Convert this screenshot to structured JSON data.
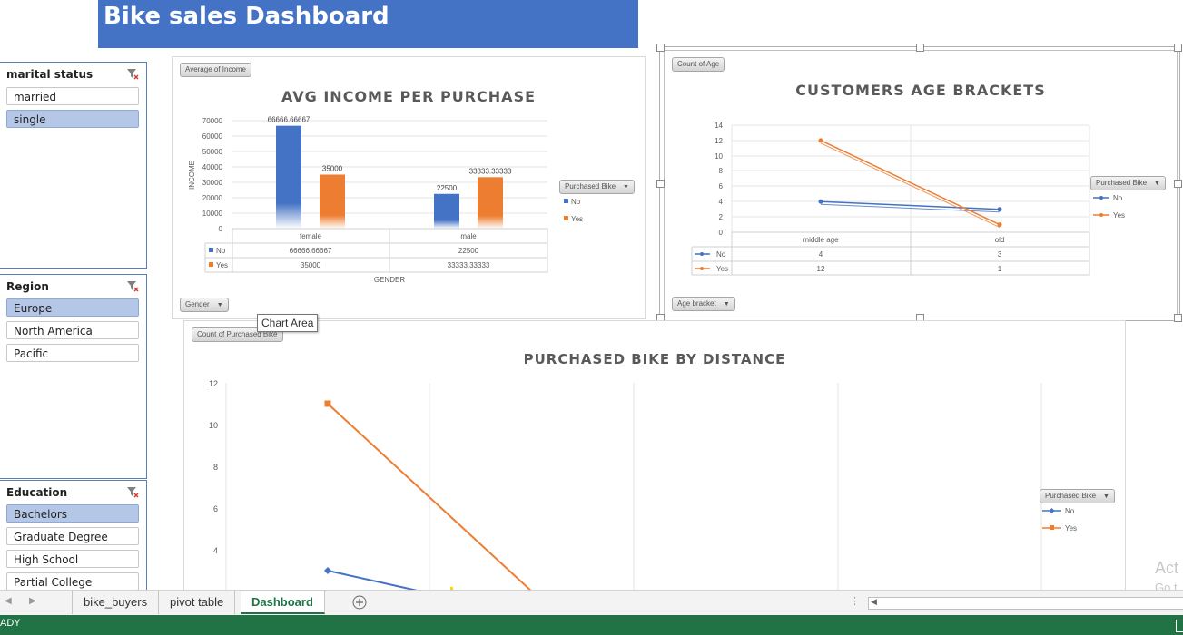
{
  "dashboard_title": "Bike sales Dashboard",
  "slicers": {
    "marital": {
      "title": "marital status",
      "items": [
        {
          "label": "married",
          "selected": false
        },
        {
          "label": "single",
          "selected": true
        }
      ]
    },
    "region": {
      "title": "Region",
      "items": [
        {
          "label": "Europe",
          "selected": true
        },
        {
          "label": "North America",
          "selected": false
        },
        {
          "label": "Pacific",
          "selected": false
        }
      ]
    },
    "education": {
      "title": "Education",
      "items": [
        {
          "label": "Bachelors",
          "selected": true
        },
        {
          "label": "Graduate Degree",
          "selected": false
        },
        {
          "label": "High School",
          "selected": false
        },
        {
          "label": "Partial College",
          "selected": false
        }
      ]
    }
  },
  "income_chart": {
    "value_button": "Average of Income",
    "axis_button": "Gender",
    "legend_button": "Purchased Bike",
    "legend_no": "No",
    "legend_yes": "Yes",
    "title": "AVG INCOME PER PURCHASE",
    "ylabel": "INCOME",
    "xlabel": "GENDER",
    "yticks": [
      "70000",
      "60000",
      "50000",
      "40000",
      "30000",
      "20000",
      "10000",
      "0"
    ],
    "categories": [
      "female",
      "male"
    ],
    "data_labels": {
      "female_no": "66666.66667",
      "female_yes": "35000",
      "male_no": "22500",
      "male_yes": "33333.33333"
    },
    "table": {
      "row_no": "No",
      "row_yes": "Yes",
      "female_no": "66666.66667",
      "male_no": "22500",
      "female_yes": "35000",
      "male_yes": "33333.33333"
    }
  },
  "age_chart": {
    "value_button": "Count of Age",
    "axis_button": "Age bracket",
    "legend_button": "Purchased Bike",
    "legend_no": "No",
    "legend_yes": "Yes",
    "title": "CUSTOMERS AGE BRACKETS",
    "yticks": [
      "14",
      "12",
      "10",
      "8",
      "6",
      "4",
      "2",
      "0"
    ],
    "categories": [
      "middle age",
      "old"
    ],
    "table": {
      "row_no": "No",
      "row_yes": "Yes",
      "mid_no": "4",
      "old_no": "3",
      "mid_yes": "12",
      "old_yes": "1"
    }
  },
  "distance_chart": {
    "value_button": "Count of Purchased Bike",
    "legend_button": "Purchased Bike",
    "legend_no": "No",
    "legend_yes": "Yes",
    "title": "PURCHASED BIKE BY DISTANCE",
    "yticks": [
      "12",
      "10",
      "8",
      "6",
      "4"
    ]
  },
  "tooltip": "Chart Area",
  "sheet_tabs": [
    "bike_buyers",
    "pivot table",
    "Dashboard"
  ],
  "status": "ADY",
  "watermark_line1": "Act",
  "watermark_line2": "Go t",
  "colors": {
    "no": "#4472c4",
    "yes": "#ed7d31",
    "banner": "#4472c4",
    "status": "#217346"
  },
  "chart_data": [
    {
      "type": "bar",
      "title": "AVG INCOME PER PURCHASE",
      "xlabel": "GENDER",
      "ylabel": "INCOME",
      "categories": [
        "female",
        "male"
      ],
      "series": [
        {
          "name": "No",
          "values": [
            66666.66667,
            22500
          ]
        },
        {
          "name": "Yes",
          "values": [
            35000,
            33333.33333
          ]
        }
      ],
      "ylim": [
        0,
        70000
      ],
      "legend": "right"
    },
    {
      "type": "line",
      "title": "CUSTOMERS AGE BRACKETS",
      "categories": [
        "middle age",
        "old"
      ],
      "series": [
        {
          "name": "No",
          "values": [
            4,
            3
          ]
        },
        {
          "name": "Yes",
          "values": [
            12,
            1
          ]
        }
      ],
      "ylim": [
        0,
        14
      ],
      "legend": "right"
    },
    {
      "type": "line",
      "title": "PURCHASED BIKE BY DISTANCE",
      "series": [
        {
          "name": "No",
          "values": [
            3
          ]
        },
        {
          "name": "Yes",
          "values": [
            11
          ]
        }
      ],
      "ylim": [
        2,
        12
      ],
      "legend": "right"
    }
  ]
}
